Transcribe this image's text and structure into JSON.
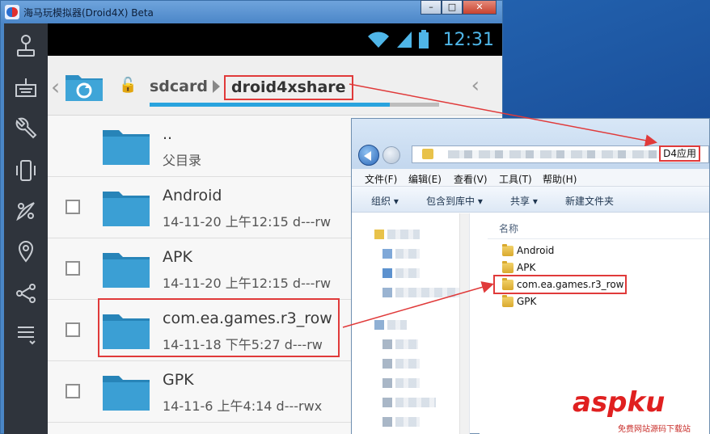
{
  "emulator": {
    "title": "海马玩模拟器(Droid4X) Beta",
    "window_buttons": {
      "minimize": "–",
      "maximize": "□",
      "close": "✕"
    },
    "clock": "12:31",
    "breadcrumb": {
      "root": "sdcard",
      "current": "droid4xshare"
    },
    "progress_fraction": 0.83,
    "files": [
      {
        "name": "..",
        "meta": "父目录",
        "checkbox": false
      },
      {
        "name": "Android",
        "meta": "14-11-20 上午12:15   d---rw",
        "checkbox": true
      },
      {
        "name": "APK",
        "meta": "14-11-20 上午12:15   d---rw",
        "checkbox": true
      },
      {
        "name": "com.ea.games.r3_row",
        "meta": "14-11-18 下午5:27   d---rw",
        "checkbox": true
      },
      {
        "name": "GPK",
        "meta": "14-11-6 上午4:14   d---rwx",
        "checkbox": true
      }
    ]
  },
  "explorer": {
    "address_crumb": "D4应用",
    "menu": [
      "文件(F)",
      "编辑(E)",
      "查看(V)",
      "工具(T)",
      "帮助(H)"
    ],
    "toolbar": [
      "组织 ▾",
      "包含到库中 ▾",
      "共享 ▾",
      "新建文件夹"
    ],
    "column_header": "名称",
    "items": [
      "Android",
      "APK",
      "com.ea.games.r3_row",
      "GPK"
    ]
  },
  "watermark": {
    "main": "aspku",
    "sub": "免费网站源码下载站"
  },
  "colors": {
    "highlight": "#e03a3a",
    "accent": "#29a3de"
  }
}
